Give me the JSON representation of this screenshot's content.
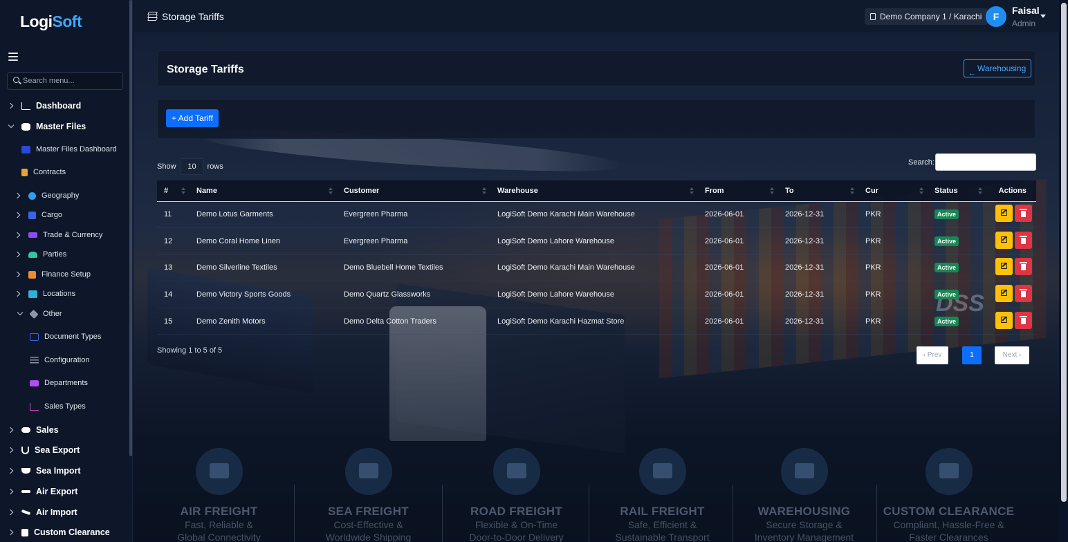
{
  "brand": {
    "logo_a": "Logi",
    "logo_b": "Soft"
  },
  "sidebar": {
    "search_placeholder": "Search menu...",
    "items": [
      {
        "label": "Dashboard",
        "icon": "chart-line-icon",
        "color": "#ffffff"
      },
      {
        "label": "Master Files",
        "icon": "database-icon",
        "color": "#ffffff"
      },
      {
        "label": "Master Files Dashboard",
        "icon": "dashboard-icon",
        "color": "#2b48d8"
      },
      {
        "label": "Contracts",
        "icon": "contract-icon",
        "color": "#f0a030"
      },
      {
        "label": "Geography",
        "icon": "globe-icon",
        "color": "#2f9cf0"
      },
      {
        "label": "Cargo",
        "icon": "box-icon",
        "color": "#3b63e8"
      },
      {
        "label": "Trade & Currency",
        "icon": "exchange-icon",
        "color": "#8a4ff0"
      },
      {
        "label": "Parties",
        "icon": "users-icon",
        "color": "#2fc8a0"
      },
      {
        "label": "Finance Setup",
        "icon": "coins-icon",
        "color": "#f08a30"
      },
      {
        "label": "Locations",
        "icon": "warehouse-icon",
        "color": "#2fb0d8"
      },
      {
        "label": "Other",
        "icon": "tag-icon",
        "color": "#8e97a8"
      },
      {
        "label": "Document Types",
        "icon": "id-card-icon",
        "color": "#3b63e8"
      },
      {
        "label": "Configuration",
        "icon": "sliders-icon",
        "color": "#8e97a8"
      },
      {
        "label": "Departments",
        "icon": "sitemap-icon",
        "color": "#b04ff0"
      },
      {
        "label": "Sales Types",
        "icon": "chart-icon",
        "color": "#d84fb0"
      },
      {
        "label": "Sales",
        "icon": "handshake-icon",
        "color": "#ffffff"
      },
      {
        "label": "Sea Export",
        "icon": "anchor-icon",
        "color": "#ffffff"
      },
      {
        "label": "Sea Import",
        "icon": "ship-icon",
        "color": "#ffffff"
      },
      {
        "label": "Air Export",
        "icon": "plane-icon",
        "color": "#ffffff"
      },
      {
        "label": "Air Import",
        "icon": "plane-arrival-icon",
        "color": "#ffffff"
      },
      {
        "label": "Custom Clearance",
        "icon": "file-shield-icon",
        "color": "#ffffff"
      }
    ]
  },
  "header": {
    "title": "Storage Tariffs",
    "company": "Demo Company 1 / Karachi",
    "user_initial": "F",
    "user_name": "Faisal",
    "user_role": "Admin"
  },
  "page": {
    "title": "Storage Tariffs",
    "back_button": "Warehousing",
    "add_button": "+ Add Tariff",
    "show_label": "Show",
    "rows_value": "10",
    "rows_label": "rows",
    "search_label": "Search:",
    "info": "Showing 1 to 5 of 5",
    "pager": {
      "prev": "‹ Prev",
      "current": "1",
      "next": "Next ›"
    }
  },
  "table": {
    "columns": [
      "#",
      "Name",
      "Customer",
      "Warehouse",
      "From",
      "To",
      "Cur",
      "Status",
      "Actions"
    ],
    "rows": [
      {
        "id": "11",
        "name": "Demo Lotus Garments",
        "customer": "Evergreen Pharma",
        "warehouse": "LogiSoft Demo Karachi Main Warehouse",
        "from": "2026-06-01",
        "to": "2026-12-31",
        "cur": "PKR",
        "status": "Active"
      },
      {
        "id": "12",
        "name": "Demo Coral Home Linen",
        "customer": "Evergreen Pharma",
        "warehouse": "LogiSoft Demo Lahore Warehouse",
        "from": "2026-06-01",
        "to": "2026-12-31",
        "cur": "PKR",
        "status": "Active"
      },
      {
        "id": "13",
        "name": "Demo Silverline Textiles",
        "customer": "Demo Bluebell Home Textiles",
        "warehouse": "LogiSoft Demo Karachi Main Warehouse",
        "from": "2026-06-01",
        "to": "2026-12-31",
        "cur": "PKR",
        "status": "Active"
      },
      {
        "id": "14",
        "name": "Demo Victory Sports Goods",
        "customer": "Demo Quartz Glassworks",
        "warehouse": "LogiSoft Demo Lahore Warehouse",
        "from": "2026-06-01",
        "to": "2026-12-31",
        "cur": "PKR",
        "status": "Active"
      },
      {
        "id": "15",
        "name": "Demo Zenith Motors",
        "customer": "Demo Delta Cotton Traders",
        "warehouse": "LogiSoft Demo Karachi Hazmat Store",
        "from": "2026-06-01",
        "to": "2026-12-31",
        "cur": "PKR",
        "status": "Active"
      }
    ]
  },
  "background": {
    "watermark": "DSS",
    "services": [
      {
        "title": "AIR FREIGHT",
        "line1": "Fast, Reliable &",
        "line2": "Global Connectivity",
        "icon": "plane-icon"
      },
      {
        "title": "SEA FREIGHT",
        "line1": "Cost-Effective &",
        "line2": "Worldwide Shipping",
        "icon": "ship-icon"
      },
      {
        "title": "ROAD FREIGHT",
        "line1": "Flexible & On-Time",
        "line2": "Door-to-Door Delivery",
        "icon": "truck-icon"
      },
      {
        "title": "RAIL FREIGHT",
        "line1": "Safe, Efficient &",
        "line2": "Sustainable Transport",
        "icon": "train-icon"
      },
      {
        "title": "WAREHOUSING",
        "line1": "Secure Storage &",
        "line2": "Inventory Management",
        "icon": "warehouse-icon"
      },
      {
        "title": "CUSTOM CLEARANCE",
        "line1": "Compliant, Hassle-Free &",
        "line2": "Faster Clearances",
        "icon": "clipboard-check-icon"
      }
    ]
  }
}
